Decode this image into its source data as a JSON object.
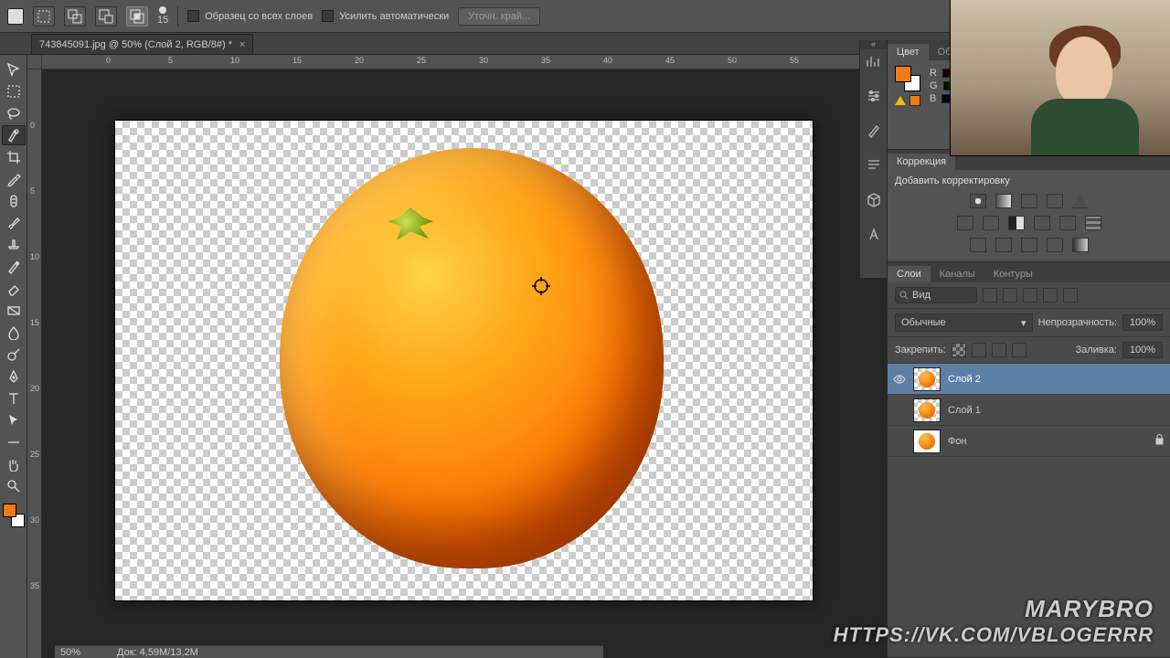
{
  "options_bar": {
    "brush_size": "15",
    "sample_all_layers": "Образец со всех слоев",
    "enhance_auto": "Усилить автоматически",
    "refine_edge": "Уточн. край..."
  },
  "document_tab": {
    "title": "743845091.jpg @ 50% (Слой 2, RGB/8#) *"
  },
  "ruler_h": [
    "0",
    "5",
    "10",
    "15",
    "20",
    "25",
    "30",
    "35",
    "40",
    "45",
    "50",
    "55"
  ],
  "ruler_v": [
    "0",
    "5",
    "10",
    "15",
    "20",
    "25",
    "30",
    "35"
  ],
  "color_panel": {
    "tabs": [
      "Цвет",
      "Обра"
    ],
    "channels": [
      "R",
      "G",
      "B"
    ]
  },
  "adjustments_panel": {
    "title": "Коррекция",
    "add_label": "Добавить корректировку"
  },
  "layers_panel": {
    "tabs": [
      "Слои",
      "Каналы",
      "Контуры"
    ],
    "filter_label": "Вид",
    "blend_mode": "Обычные",
    "opacity_label": "Непрозрачность:",
    "opacity_value": "100%",
    "lock_label": "Закрепить:",
    "fill_label": "Заливка:",
    "fill_value": "100%",
    "layers": [
      {
        "name": "Слой 2",
        "visible": true,
        "selected": true,
        "locked": false
      },
      {
        "name": "Слой 1",
        "visible": false,
        "selected": false,
        "locked": false
      },
      {
        "name": "Фон",
        "visible": false,
        "selected": false,
        "locked": true
      }
    ]
  },
  "status_bar": {
    "zoom": "50%",
    "doc": "Док: 4,59M/13,2M"
  },
  "watermark": {
    "line1": "MARYBRO",
    "line2": "HTTPS://VK.COM/VBLOGERRR"
  }
}
